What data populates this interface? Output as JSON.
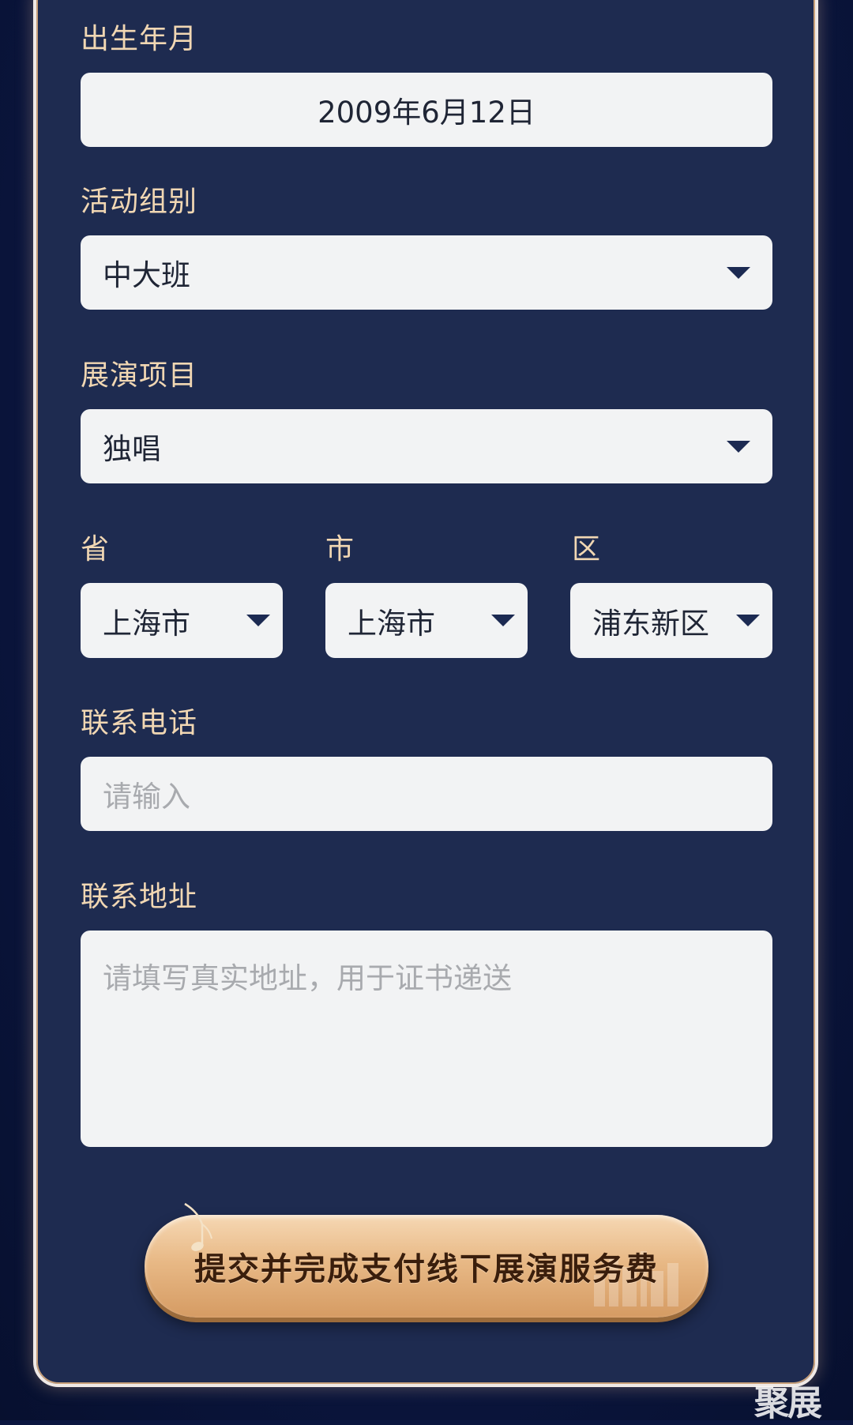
{
  "form": {
    "birth": {
      "label": "出生年月",
      "value": "2009年6月12日"
    },
    "group": {
      "label": "活动组别",
      "value": "中大班"
    },
    "project": {
      "label": "展演项目",
      "value": "独唱"
    },
    "region": {
      "province_label": "省",
      "province_value": "上海市",
      "city_label": "市",
      "city_value": "上海市",
      "district_label": "区",
      "district_value": "浦东新区"
    },
    "phone": {
      "label": "联系电话",
      "placeholder": "请输入"
    },
    "address": {
      "label": "联系地址",
      "placeholder": "请填写真实地址，用于证书递送"
    }
  },
  "submit": {
    "label": "提交并完成支付线下展演服务费"
  },
  "watermark": {
    "text": "聚展"
  },
  "colors": {
    "background": "#0b1640",
    "card": "#1e2b50",
    "label": "#f1d7b3",
    "field": "#f2f3f4",
    "button_gold": "#e8b986"
  },
  "icons": {
    "dropdown": "caret-down-icon",
    "decoration": "music-note-icon"
  }
}
